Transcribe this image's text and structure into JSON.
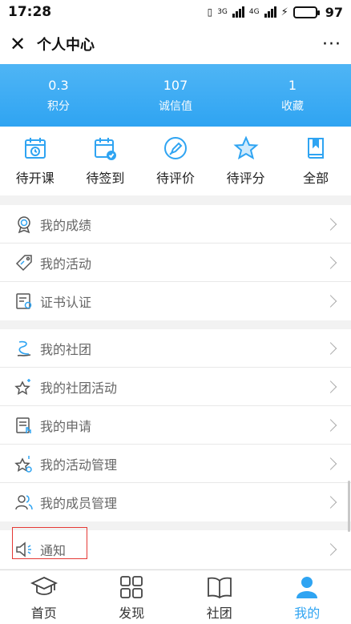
{
  "status_bar": {
    "time": "17:28",
    "net1": "3G",
    "net2": "4G",
    "battery": "97"
  },
  "nav": {
    "title": "个人中心",
    "more": "···"
  },
  "stats": [
    {
      "value": "0.3",
      "label": "积分"
    },
    {
      "value": "107",
      "label": "诚信值"
    },
    {
      "value": "1",
      "label": "收藏"
    }
  ],
  "orders": [
    {
      "label": "待开课",
      "icon": "calendar-clock-icon"
    },
    {
      "label": "待签到",
      "icon": "calendar-check-icon"
    },
    {
      "label": "待评价",
      "icon": "pen-circle-icon"
    },
    {
      "label": "待评分",
      "icon": "star-icon"
    },
    {
      "label": "全部",
      "icon": "book-icon"
    }
  ],
  "group1": [
    {
      "label": "我的成绩",
      "icon": "medal-icon"
    },
    {
      "label": "我的活动",
      "icon": "tag-icon"
    },
    {
      "label": "证书认证",
      "icon": "certificate-icon"
    }
  ],
  "group2": [
    {
      "label": "我的社团",
      "icon": "club-icon"
    },
    {
      "label": "我的社团活动",
      "icon": "star-sparkle-icon"
    },
    {
      "label": "我的申请",
      "icon": "document-hand-icon"
    },
    {
      "label": "我的活动管理",
      "icon": "star-gear-icon"
    },
    {
      "label": "我的成员管理",
      "icon": "members-icon"
    }
  ],
  "group3": [
    {
      "label": "通知",
      "icon": "speaker-icon"
    }
  ],
  "tabs": [
    {
      "label": "首页",
      "icon": "graduation-cap-icon"
    },
    {
      "label": "发现",
      "icon": "grid-icon"
    },
    {
      "label": "社团",
      "icon": "open-book-icon"
    },
    {
      "label": "我的",
      "icon": "user-icon"
    }
  ],
  "colors": {
    "accent": "#2fa4f2",
    "highlight": "#e53935"
  }
}
